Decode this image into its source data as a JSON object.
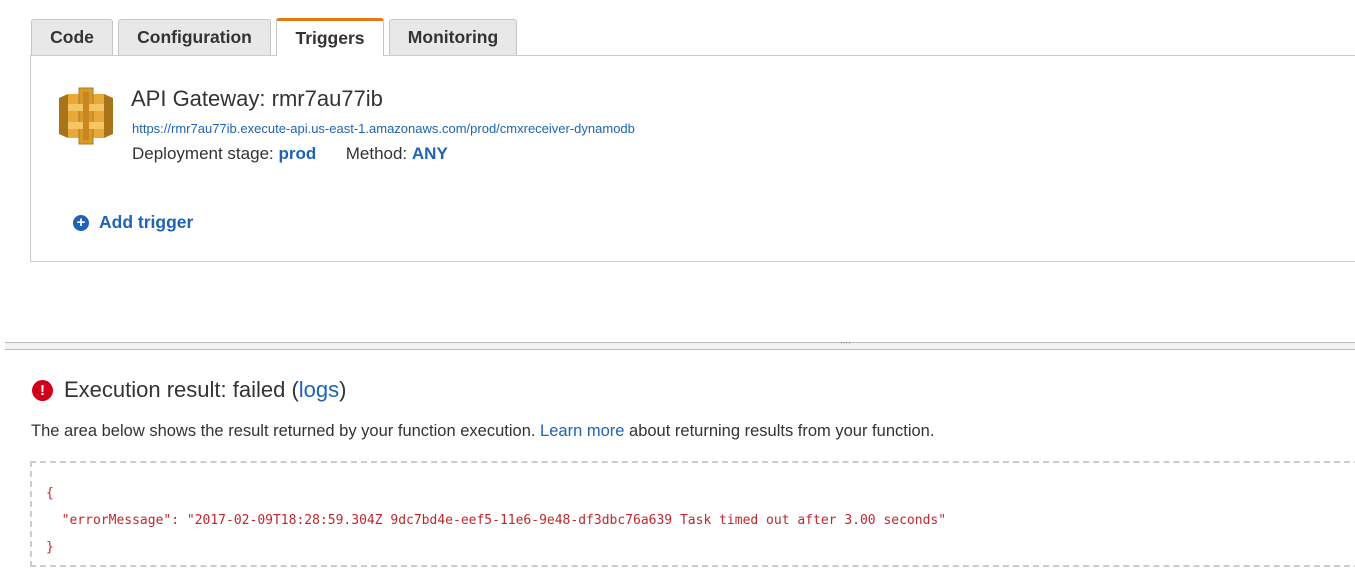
{
  "tabs": [
    {
      "label": "Code"
    },
    {
      "label": "Configuration"
    },
    {
      "label": "Triggers",
      "active": true
    },
    {
      "label": "Monitoring"
    }
  ],
  "trigger": {
    "title": "API Gateway: rmr7au77ib",
    "url": "https://rmr7au77ib.execute-api.us-east-1.amazonaws.com/prod/cmxreceiver-dynamodb",
    "stage_label": "Deployment stage:",
    "stage_value": "prod",
    "method_label": "Method:",
    "method_value": "ANY",
    "icon": "api-gateway-icon"
  },
  "add_trigger": {
    "label": "Add trigger",
    "icon": "plus-circle-icon"
  },
  "execution": {
    "title_prefix": "Execution result: failed (",
    "logs_link": "logs",
    "title_suffix": ")",
    "icon": "error-icon",
    "description_prefix": "The area below shows the result returned by your function execution.",
    "learn_more": "Learn more",
    "description_suffix": "about returning results from your function.",
    "result_lines": [
      "{",
      "  \"errorMessage\": \"2017-02-09T18:28:59.304Z 9dc7bd4e-eef5-11e6-9e48-df3dbc76a639 Task timed out after 3.00 seconds\"",
      "}"
    ]
  },
  "colors": {
    "link": "#1f63b5",
    "active_tab_accent": "#e07b12",
    "error": "#d0021b",
    "code_text": "#c0272d"
  }
}
